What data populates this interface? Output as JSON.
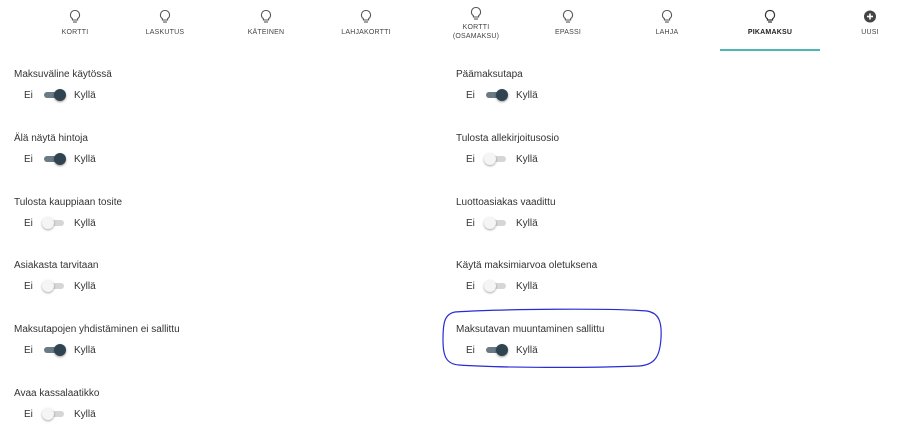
{
  "tabs": [
    {
      "label": "KORTTI",
      "icon": "lightbulb-icon"
    },
    {
      "label": "LASKUTUS",
      "icon": "lightbulb-icon"
    },
    {
      "label": "KÄTEINEN",
      "icon": "lightbulb-icon"
    },
    {
      "label": "LAHJAKORTTI",
      "icon": "lightbulb-icon"
    },
    {
      "label_line1": "KORTTI",
      "label_line2": "(OSAMAKSU)",
      "icon": "lightbulb-icon"
    },
    {
      "label": "EPASSI",
      "icon": "lightbulb-icon"
    },
    {
      "label": "LAHJA",
      "icon": "lightbulb-icon"
    },
    {
      "label": "PIKAMAKSU",
      "icon": "lightbulb-icon",
      "active": true
    },
    {
      "label": "UUSI",
      "icon": "add-circle-icon"
    }
  ],
  "toggle_labels": {
    "off": "Ei",
    "on": "Kyllä"
  },
  "settings": [
    {
      "title": "Maksuväline käytössä",
      "enabled": true
    },
    {
      "title": "Päämaksutapa",
      "enabled": true
    },
    {
      "title": "Älä näytä hintoja",
      "enabled": true
    },
    {
      "title": "Tulosta allekirjoitusosio",
      "enabled": false
    },
    {
      "title": "Tulosta kauppiaan tosite",
      "enabled": false
    },
    {
      "title": "Luottoasiakas vaadittu",
      "enabled": false
    },
    {
      "title": "Asiakasta tarvitaan",
      "enabled": false
    },
    {
      "title": "Käytä maksimiarvoa oletuksena",
      "enabled": false
    },
    {
      "title": "Maksutapojen yhdistäminen ei sallittu",
      "enabled": true
    },
    {
      "title": "Maksutavan muuntaminen sallittu",
      "enabled": true
    },
    {
      "title": "Avaa kassalaatikko",
      "enabled": false
    }
  ],
  "colors": {
    "active_tab_underline": "#4fb7b3",
    "toggle_on_thumb": "#2f4450",
    "toggle_on_track": "#6b7b86",
    "toggle_off_track": "#d6d6d6",
    "annotation": "#2a2ad6"
  }
}
